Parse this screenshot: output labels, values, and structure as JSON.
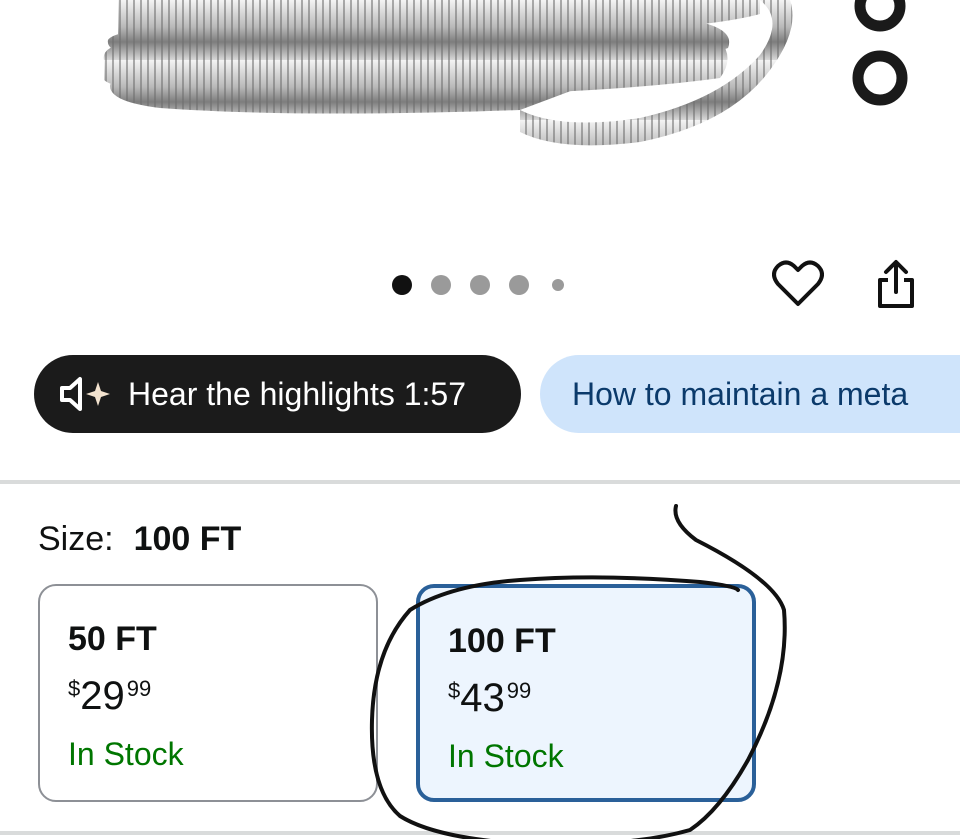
{
  "carousel": {
    "dot_count": 5,
    "active_index": 0
  },
  "actions": {
    "wishlist_icon": "heart-icon",
    "share_icon": "share-icon"
  },
  "pills": {
    "highlights": {
      "icon": "speaker-sparkle-icon",
      "label": "Hear the highlights 1:57"
    },
    "question": {
      "label": "How to maintain a meta"
    }
  },
  "size": {
    "label": "Size:",
    "selected": "100 FT",
    "options": [
      {
        "name": "50 FT",
        "price_symbol": "$",
        "price_whole": "29",
        "price_fraction": "99",
        "availability": "In Stock",
        "selected": false
      },
      {
        "name": "100 FT",
        "price_symbol": "$",
        "price_whole": "43",
        "price_fraction": "99",
        "availability": "In Stock",
        "selected": true
      }
    ]
  },
  "colors": {
    "dark_pill": "#1b1b1b",
    "light_pill": "#cfe4fb",
    "selected_border": "#2a6099",
    "stock_green": "#007600"
  }
}
